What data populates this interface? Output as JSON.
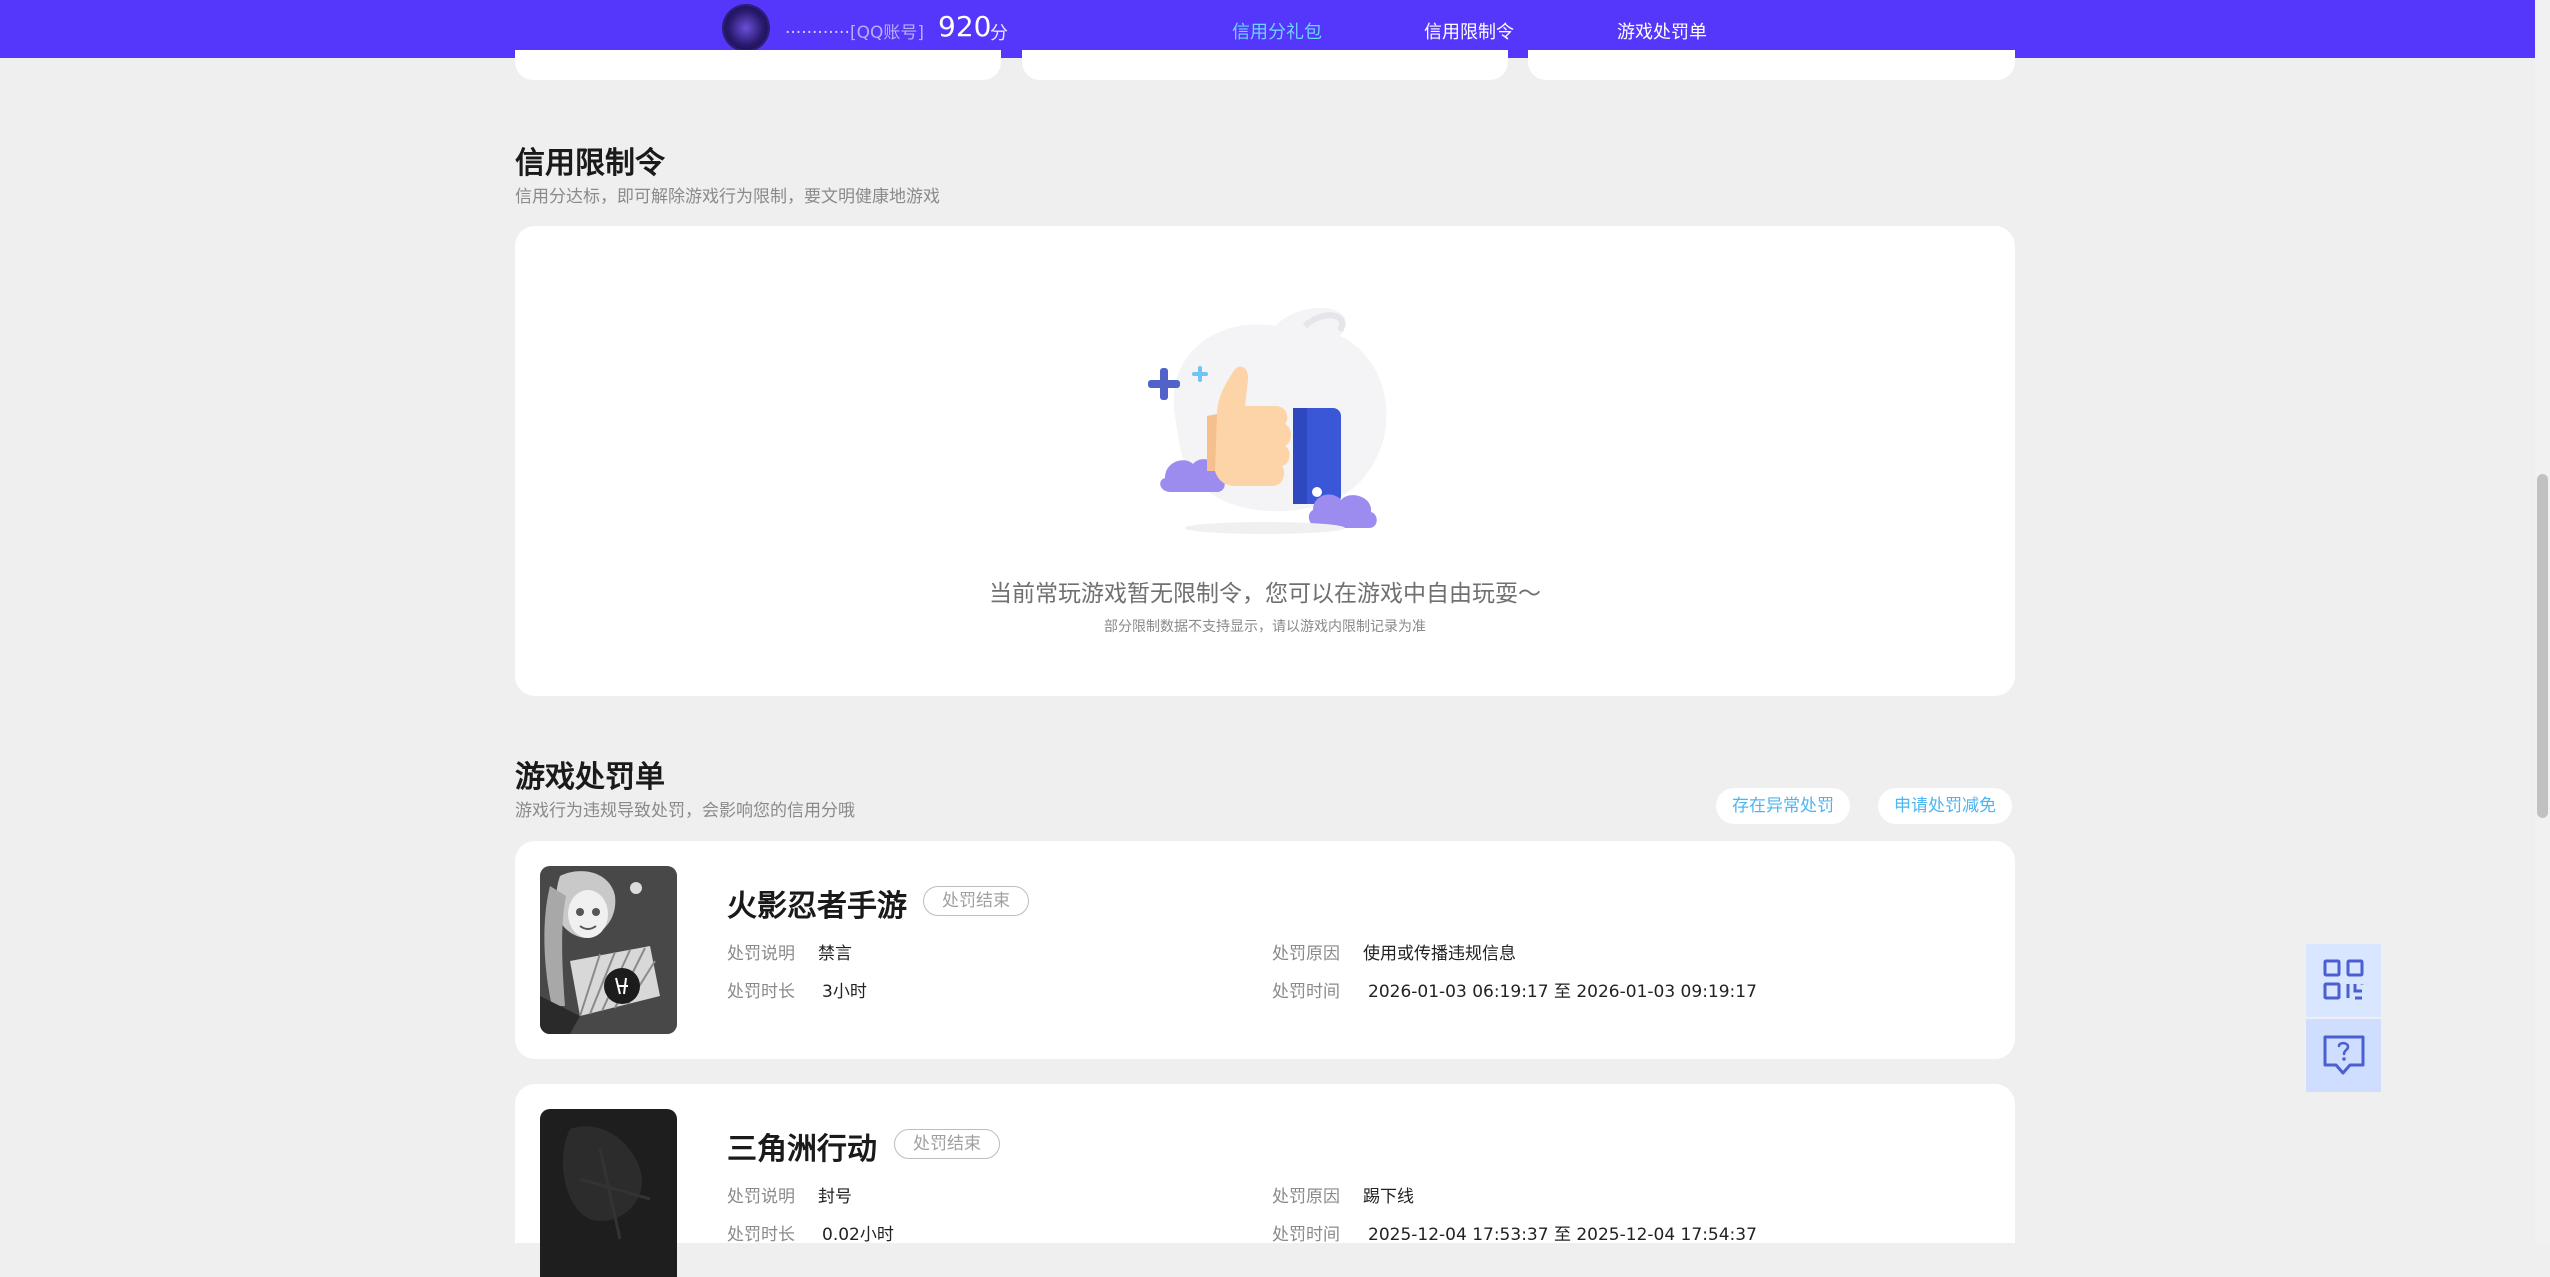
{
  "topbar": {
    "account_name": "............",
    "account_type": "[QQ账号]",
    "score": "920",
    "score_unit": "分",
    "tabs": [
      {
        "label": "信用分礼包",
        "active": true
      },
      {
        "label": "信用限制令",
        "active": false
      },
      {
        "label": "游戏处罚单",
        "active": false
      }
    ]
  },
  "restriction": {
    "title": "信用限制令",
    "subtitle": "信用分达标，即可解除游戏行为限制，要文明健康地游戏",
    "empty_title": "当前常玩游戏暂无限制令，您可以在游戏中自由玩耍～",
    "empty_note": "部分限制数据不支持显示，请以游戏内限制记录为准"
  },
  "penalty": {
    "title": "游戏处罚单",
    "subtitle": "游戏行为违规导致处罚，会影响您的信用分哦",
    "appeal_button": "存在异常处罚",
    "reduce_button": "申请处罚减免",
    "labels": {
      "desc": "处罚说明",
      "duration": "处罚时长",
      "reason": "处罚原因",
      "time": "处罚时间"
    },
    "items": [
      {
        "game": "火影忍者手游",
        "status": "处罚结束",
        "desc": "禁言",
        "duration": "3小时",
        "reason": "使用或传播违规信息",
        "time": "2026-01-03 06:19:17 至 2026-01-03 09:19:17"
      },
      {
        "game": "三角洲行动",
        "status": "处罚结束",
        "desc": "封号",
        "duration": "0.02小时",
        "reason": "踢下线",
        "time": "2025-12-04 17:53:37 至 2025-12-04 17:54:37"
      }
    ]
  },
  "float": {
    "qr_icon": "qrcode-icon",
    "help_icon": "help-chat-icon"
  },
  "colors": {
    "topbar": "#5536fb",
    "active_tab": "#6fd2ff",
    "link": "#4cb6f2",
    "background": "#efefef"
  }
}
